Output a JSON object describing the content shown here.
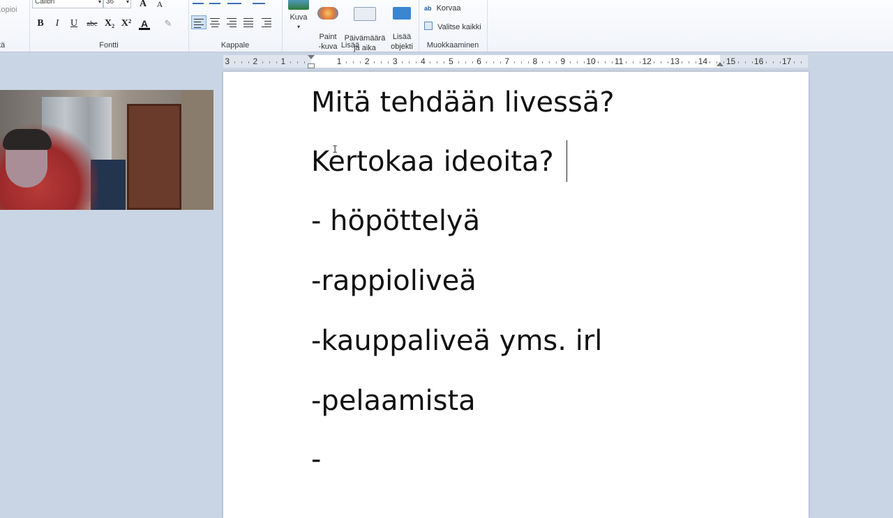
{
  "ribbon": {
    "clipboard": {
      "copy_label": "Kopioi",
      "group_label_fragment": "tä"
    },
    "font": {
      "group_label": "Fontti",
      "font_name": "Calibri",
      "font_size": "36",
      "buttons": {
        "bold": "B",
        "italic": "I",
        "underline": "U",
        "strikethrough": "abc",
        "subscript": "X₂",
        "superscript": "X²",
        "font_color": "A"
      }
    },
    "paragraph": {
      "group_label": "Kappale"
    },
    "insert": {
      "group_label": "Lisää",
      "buttons": [
        {
          "label": "Kuva"
        },
        {
          "label": "Paint\n-kuva"
        },
        {
          "label": "Päivämäärä\nja aika"
        },
        {
          "label": "Lisää\nobjekti"
        }
      ]
    },
    "editing": {
      "group_label": "Muokkaaminen",
      "replace_label": "Korvaa",
      "select_all_label": "Valitse kaikki"
    }
  },
  "ruler": {
    "labels": [
      "3",
      "2",
      "1",
      "1",
      "2",
      "3",
      "4",
      "5",
      "6",
      "7",
      "8",
      "9",
      "10",
      "11",
      "12",
      "13",
      "14",
      "15",
      "16",
      "17"
    ]
  },
  "document": {
    "lines": [
      "Mitä tehdään livessä?",
      "Kertokaa ideoita?",
      "- höpöttelyä",
      "-rappioliveä",
      "-kauppaliveä yms. irl",
      "-pelaamista",
      "-"
    ]
  },
  "colors": {
    "accent": "#2b579a",
    "app_background": "#c9d5e4"
  }
}
